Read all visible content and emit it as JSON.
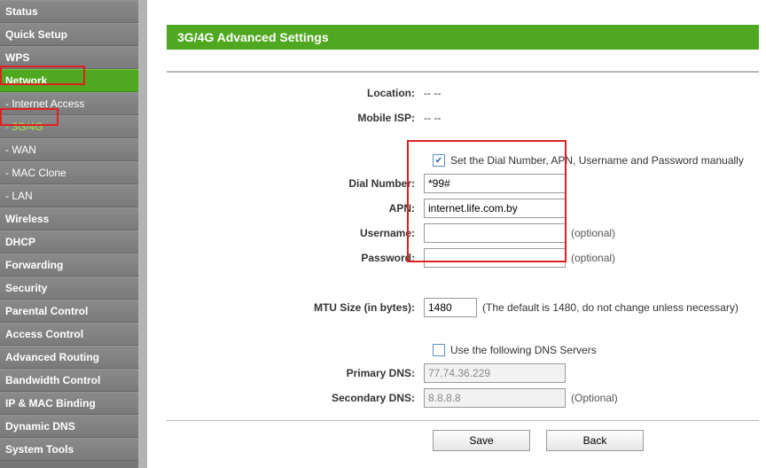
{
  "sidebar": {
    "items": [
      {
        "label": "Status"
      },
      {
        "label": "Quick Setup"
      },
      {
        "label": "WPS"
      },
      {
        "label": "Network",
        "active": true
      },
      {
        "label": "- Internet Access",
        "sub": true
      },
      {
        "label": "- 3G/4G",
        "sub": true,
        "subActive": true
      },
      {
        "label": "- WAN",
        "sub": true
      },
      {
        "label": "- MAC Clone",
        "sub": true
      },
      {
        "label": "- LAN",
        "sub": true
      },
      {
        "label": "Wireless"
      },
      {
        "label": "DHCP"
      },
      {
        "label": "Forwarding"
      },
      {
        "label": "Security"
      },
      {
        "label": "Parental Control"
      },
      {
        "label": "Access Control"
      },
      {
        "label": "Advanced Routing"
      },
      {
        "label": "Bandwidth Control"
      },
      {
        "label": "IP & MAC Binding"
      },
      {
        "label": "Dynamic DNS"
      },
      {
        "label": "System Tools"
      }
    ]
  },
  "page": {
    "title": "3G/4G Advanced Settings",
    "save_label": "Save",
    "back_label": "Back"
  },
  "labels": {
    "location": "Location:",
    "mobile_isp": "Mobile ISP:",
    "manual_checkbox": "Set the Dial Number, APN, Username and Password manually",
    "dial_number": "Dial Number:",
    "apn": "APN:",
    "username": "Username:",
    "password": "Password:",
    "mtu": "MTU Size (in bytes):",
    "mtu_hint": "(The default is 1480, do not change unless necessary)",
    "use_dns": "Use the following DNS Servers",
    "primary_dns": "Primary DNS:",
    "secondary_dns": "Secondary DNS:",
    "optional": "(optional)",
    "optional_cap": "(Optional)"
  },
  "values": {
    "location": "-- --",
    "mobile_isp": "-- --",
    "manual_checked": true,
    "dial_number": "*99#",
    "apn": "internet.life.com.by",
    "username": "",
    "password": "",
    "mtu": "1480",
    "use_dns_checked": false,
    "primary_dns": "77.74.36.229",
    "secondary_dns": "8.8.8.8"
  }
}
